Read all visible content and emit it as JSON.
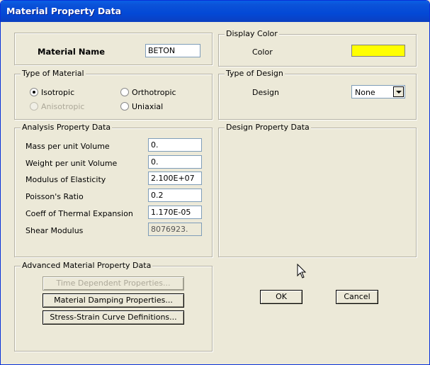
{
  "window": {
    "title": "Material Property Data"
  },
  "material_name": {
    "label": "Material Name",
    "value": "BETON"
  },
  "display_color": {
    "group": "Display Color",
    "label": "Color",
    "color": "#ffff00"
  },
  "type_of_material": {
    "group": "Type of Material",
    "options": {
      "isotropic": "Isotropic",
      "orthotropic": "Orthotropic",
      "anisotropic": "Anisotropic",
      "uniaxial": "Uniaxial"
    },
    "selected": "isotropic"
  },
  "type_of_design": {
    "group": "Type of Design",
    "label": "Design",
    "value": "None"
  },
  "analysis": {
    "group": "Analysis Property Data",
    "mass_label": "Mass per unit Volume",
    "mass_value": "0.",
    "weight_label": "Weight per unit Volume",
    "weight_value": "0.",
    "modulus_label": "Modulus of Elasticity",
    "modulus_value": "2.100E+07",
    "poisson_label": "Poisson's Ratio",
    "poisson_value": "0.2",
    "thermal_label": "Coeff of Thermal Expansion",
    "thermal_value": "1.170E-05",
    "shear_label": "Shear Modulus",
    "shear_value": "8076923."
  },
  "design_property": {
    "group": "Design Property Data"
  },
  "advanced": {
    "group": "Advanced Material Property Data",
    "time_dependent": "Time Dependent Properties...",
    "damping": "Material Damping Properties...",
    "stress_strain": "Stress-Strain Curve Definitions..."
  },
  "buttons": {
    "ok": "OK",
    "cancel": "Cancel"
  }
}
